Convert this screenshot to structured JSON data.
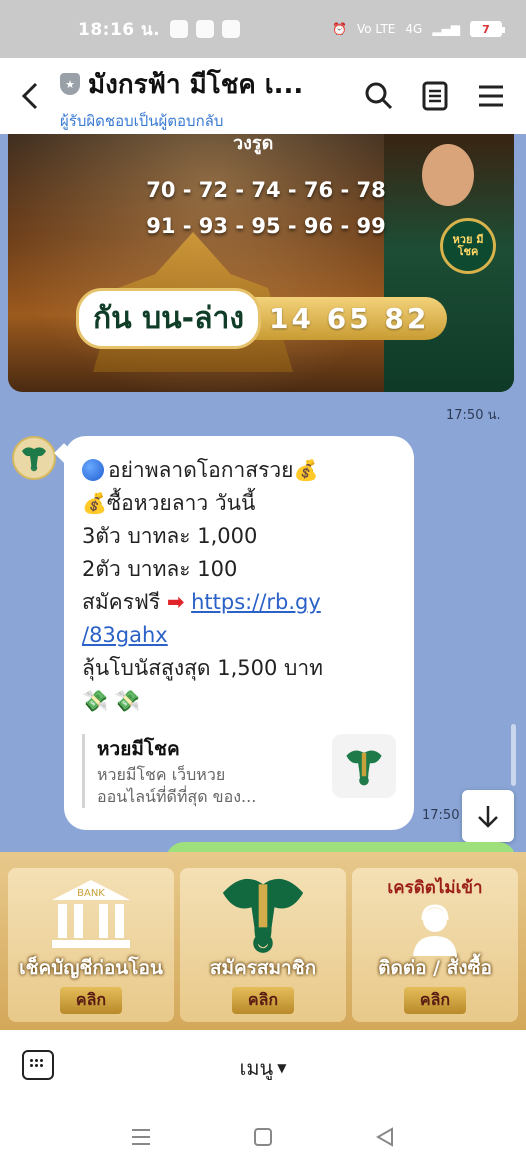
{
  "status_bar": {
    "time": "18:16 น.",
    "network": "4G",
    "volte": "Vo LTE",
    "battery": "7"
  },
  "header": {
    "title": "มังกรฟ้า มีโชค เ...",
    "subtitle": "ผู้รับผิดชอบเป็นผู้ตอบกลับ"
  },
  "banner": {
    "top_text": "วงรูด",
    "numbers_row1": "70 - 72 - 74 - 76 - 78",
    "numbers_row2": "91 - 93 - 95 - 96 - 99",
    "pill_label": "กัน บน-ล่าง",
    "pill_value": "14  65  82",
    "badge_text": "หวย มีโชค"
  },
  "timestamps": {
    "banner_time": "17:50 น.",
    "message_time": "17:50"
  },
  "message": {
    "line1": "อย่าพลาดโอกาสรวย",
    "line2": "ซื้อหวยลาว วันนี้",
    "line3": "3ตัว บาทละ 1,000",
    "line4": "2ตัว บาทละ 100",
    "line5_prefix": "สมัครฟรี",
    "link_part1": "https://rb.gy",
    "link_part2": "/83gahx",
    "line7": "ลุ้นโบนัสสูงสุด 1,500 บาท"
  },
  "link_preview": {
    "title": "หวยมีโชค",
    "desc_line1": "หวยมีโชค เว็บหวย",
    "desc_line2": "ออนไลน์ที่ดีที่สุด ของ..."
  },
  "rich_menu": {
    "tiles": [
      {
        "art_text": "BANK",
        "label": "เช็คบัญชีก่อนโอน",
        "button": "คลิก"
      },
      {
        "label": "สมัครสมาชิก",
        "button": "คลิก"
      },
      {
        "top_text": "เครดิตไม่เข้า",
        "label": "ติดต่อ / สั่งซื้อ",
        "button": "คลิก"
      }
    ]
  },
  "bottom_bar": {
    "menu_label": "เมนู"
  },
  "colors": {
    "chat_bg": "#8aa5d6",
    "link": "#2b62c8",
    "subtitle": "#3a7bd5",
    "menu_gold": "#d4a85a"
  }
}
